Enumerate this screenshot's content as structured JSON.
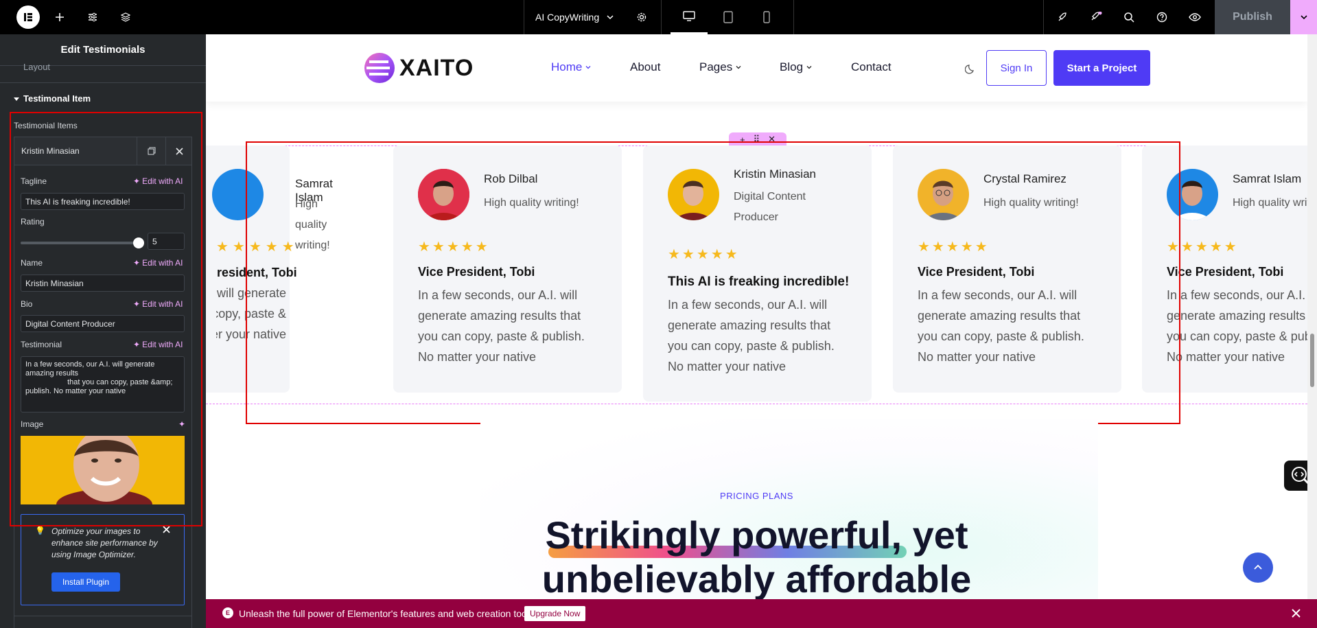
{
  "topbar": {
    "logo": "E",
    "site_name": "AI CopyWriting",
    "publish_label": "Publish"
  },
  "panel": {
    "title": "Edit Testimonials",
    "prev_section": "Layout",
    "section_title": "Testimonal Item",
    "items_label": "Testimonial Items",
    "current_item": "Kristin Minasian",
    "tagline_label": "Tagline",
    "tagline_value": "This AI is freaking incredible!",
    "rating_label": "Rating",
    "rating_value": "5",
    "rating_fraction": 1.0,
    "name_label": "Name",
    "name_value": "Kristin Minasian",
    "bio_label": "Bio",
    "bio_value": "Digital Content Producer",
    "testimonial_label": "Testimonial",
    "testimonial_value": "In a few seconds, our A.I. will generate amazing results\n                    that you can copy, paste &amp; publish. No matter your native",
    "image_label": "Image",
    "edit_ai": "Edit with AI",
    "notice_text": "Optimize your images to enhance site performance by using Image Optimizer.",
    "install_label": "Install Plugin"
  },
  "site": {
    "logo_text": "XAITO",
    "nav": [
      "Home",
      "About",
      "Pages",
      "Blog",
      "Contact"
    ],
    "signin": "Sign In",
    "cta": "Start a Project"
  },
  "cards": [
    {
      "name": "Samrat Islam",
      "tagline": "High quality writing!",
      "stars": "★★★★★",
      "title": "Vice President, Tobi",
      "text": "In a few seconds, our A.I. will generate amazing results that you can copy, paste & publish. No matter your native"
    },
    {
      "name": "Rob Dilbal",
      "tagline": "High quality writing!",
      "stars": "★★★★★",
      "title": "Vice President, Tobi",
      "text": "In a few seconds, our A.I. will generate amazing results that you can copy, paste & publish. No matter your native"
    },
    {
      "name": "Kristin Minasian",
      "tagline": "Digital Content Producer",
      "stars": "★★★★★",
      "title": "This AI is freaking incredible!",
      "text": "In a few seconds, our A.I. will generate amazing results that you can copy, paste & publish. No matter your native"
    },
    {
      "name": "Crystal Ramirez",
      "tagline": "High quality writing!",
      "stars": "★★★★★",
      "title": "Vice President, Tobi",
      "text": "In a few seconds, our A.I. will generate amazing results that you can copy, paste & publish. No matter your native"
    },
    {
      "name": "Samrat Islam",
      "tagline": "High quality writing!",
      "stars": "★★★★★",
      "title": "Vice President, Tobi",
      "text": "In a few seconds, our A.I. will generate amazing results that you can copy, paste & publish. No matter your native"
    }
  ],
  "pricing": {
    "eyebrow": "PRICING PLANS",
    "heading_line1": "Strikingly powerful, yet",
    "heading_line2": "unbelievably affordable"
  },
  "promo": {
    "text": "Unleash the full power of Elementor's features and web creation tools.",
    "button": "Upgrade Now"
  },
  "colors": {
    "accent": "#4f3bf5",
    "editor_pink": "#f0abfc",
    "promo_bg": "#93003f",
    "star": "#f6b91d",
    "highlight_red": "#e00000"
  }
}
